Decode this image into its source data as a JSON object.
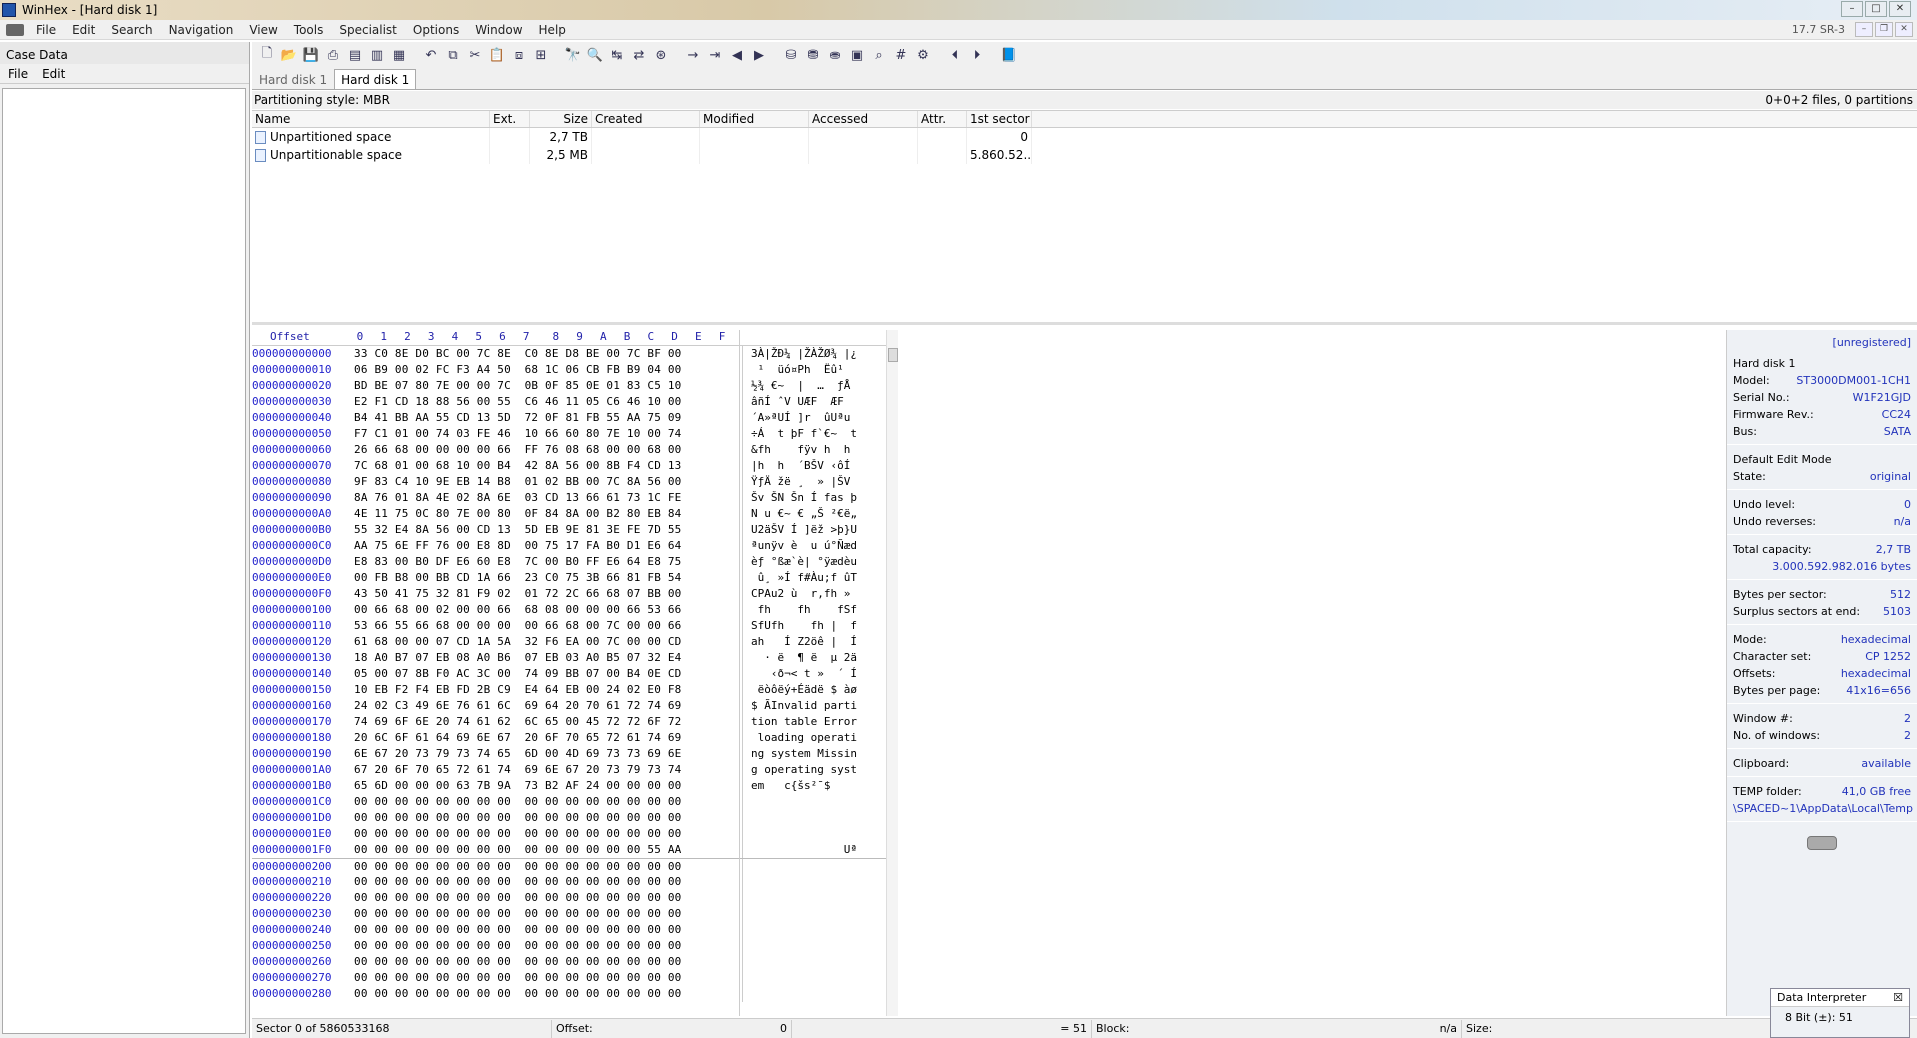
{
  "window": {
    "title": "WinHex - [Hard disk 1]",
    "version": "17.7 SR-3"
  },
  "menu": [
    "File",
    "Edit",
    "Search",
    "Navigation",
    "View",
    "Tools",
    "Specialist",
    "Options",
    "Window",
    "Help"
  ],
  "case_panel": {
    "title": "Case Data",
    "menu": [
      "File",
      "Edit"
    ]
  },
  "tabs": [
    "Hard disk 1",
    "Hard disk 1"
  ],
  "info": {
    "partitioning": "Partitioning style: MBR",
    "summary": "0+0+2 files, 0 partitions"
  },
  "file_list": {
    "columns": [
      "Name",
      "Ext.",
      "Size",
      "Created",
      "Modified",
      "Accessed",
      "Attr.",
      "1st sector ▴"
    ],
    "rows": [
      [
        "Unpartitioned space",
        "",
        "2,7 TB",
        "",
        "",
        "",
        "",
        "0"
      ],
      [
        "Unpartitionable space",
        "",
        "2,5 MB",
        "",
        "",
        "",
        "",
        "5.860.52..."
      ]
    ]
  },
  "hex": {
    "header_offset": "Offset",
    "columns": [
      "0",
      "1",
      "2",
      "3",
      "4",
      "5",
      "6",
      "7",
      "8",
      "9",
      "A",
      "B",
      "C",
      "D",
      "E",
      "F"
    ],
    "rows": [
      [
        "000000000000",
        "33 C0 8E D0 BC 00 7C 8E  C0 8E D8 BE 00 7C BF 00",
        "3À|ŽÐ¼ |ŽÀŽØ¾ |¿"
      ],
      [
        "000000000010",
        "06 B9 00 02 FC F3 A4 50  68 1C 06 CB FB B9 04 00",
        " ¹  üó¤Ph  Ëû¹ "
      ],
      [
        "000000000020",
        "BD BE 07 80 7E 00 00 7C  0B 0F 85 0E 01 83 C5 10",
        "½¾ €~  |  …  ƒÅ"
      ],
      [
        "000000000030",
        "E2 F1 CD 18 88 56 00 55  C6 46 11 05 C6 46 10 00",
        "âñÍ ˆV UÆF  ÆF"
      ],
      [
        "000000000040",
        "B4 41 BB AA 55 CD 13 5D  72 0F 81 FB 55 AA 75 09",
        "´A»ªUÍ ]r  ûUªu"
      ],
      [
        "000000000050",
        "F7 C1 01 00 74 03 FE 46  10 66 60 80 7E 10 00 74",
        "÷Á  t þF f`€~  t"
      ],
      [
        "000000000060",
        "26 66 68 00 00 00 00 66  FF 76 08 68 00 00 68 00",
        "&fh    fÿv h  h"
      ],
      [
        "000000000070",
        "7C 68 01 00 68 10 00 B4  42 8A 56 00 8B F4 CD 13",
        "|h  h  ´BŠV ‹ôÍ"
      ],
      [
        "000000000080",
        "9F 83 C4 10 9E EB 14 B8  01 02 BB 00 7C 8A 56 00",
        "ŸƒÄ žë ¸  » |ŠV"
      ],
      [
        "000000000090",
        "8A 76 01 8A 4E 02 8A 6E  03 CD 13 66 61 73 1C FE",
        "Šv ŠN Šn Í fas þ"
      ],
      [
        "0000000000A0",
        "4E 11 75 0C 80 7E 00 80  0F 84 8A 00 B2 80 EB 84",
        "N u €~ € „Š ²€ë„"
      ],
      [
        "0000000000B0",
        "55 32 E4 8A 56 00 CD 13  5D EB 9E 81 3E FE 7D 55",
        "U2äŠV Í ]ëž >þ}U"
      ],
      [
        "0000000000C0",
        "AA 75 6E FF 76 00 E8 8D  00 75 17 FA B0 D1 E6 64",
        "ªunÿv è  u ú°Ñæd"
      ],
      [
        "0000000000D0",
        "E8 83 00 B0 DF E6 60 E8  7C 00 B0 FF E6 64 E8 75",
        "èƒ °ßæ`è| °ÿædèu"
      ],
      [
        "0000000000E0",
        "00 FB B8 00 BB CD 1A 66  23 C0 75 3B 66 81 FB 54",
        " û¸ »Í f#Àu;f ûT"
      ],
      [
        "0000000000F0",
        "43 50 41 75 32 81 F9 02  01 72 2C 66 68 07 BB 00",
        "CPAu2 ù  r,fh »"
      ],
      [
        "000000000100",
        "00 66 68 00 02 00 00 66  68 08 00 00 00 66 53 66",
        " fh    fh    fSf"
      ],
      [
        "000000000110",
        "53 66 55 66 68 00 00 00  00 66 68 00 7C 00 00 66",
        "SfUfh    fh |  f"
      ],
      [
        "000000000120",
        "61 68 00 00 07 CD 1A 5A  32 F6 EA 00 7C 00 00 CD",
        "ah   Í Z2öê |  Í"
      ],
      [
        "000000000130",
        "18 A0 B7 07 EB 08 A0 B6  07 EB 03 A0 B5 07 32 E4",
        "  · ë  ¶ ë  µ 2ä"
      ],
      [
        "000000000140",
        "05 00 07 8B F0 AC 3C 00  74 09 BB 07 00 B4 0E CD",
        "   ‹ð¬< t »  ´ Í"
      ],
      [
        "000000000150",
        "10 EB F2 F4 EB FD 2B C9  E4 64 EB 00 24 02 E0 F8",
        " ëòôëý+Éädë $ àø"
      ],
      [
        "000000000160",
        "24 02 C3 49 6E 76 61 6C  69 64 20 70 61 72 74 69",
        "$ ÃInvalid parti"
      ],
      [
        "000000000170",
        "74 69 6F 6E 20 74 61 62  6C 65 00 45 72 72 6F 72",
        "tion table Error"
      ],
      [
        "000000000180",
        "20 6C 6F 61 64 69 6E 67  20 6F 70 65 72 61 74 69",
        " loading operati"
      ],
      [
        "000000000190",
        "6E 67 20 73 79 73 74 65  6D 00 4D 69 73 73 69 6E",
        "ng system Missin"
      ],
      [
        "0000000001A0",
        "67 20 6F 70 65 72 61 74  69 6E 67 20 73 79 73 74",
        "g operating syst"
      ],
      [
        "0000000001B0",
        "65 6D 00 00 00 63 7B 9A  73 B2 AF 24 00 00 00 00",
        "em   c{šs²¯$"
      ],
      [
        "0000000001C0",
        "00 00 00 00 00 00 00 00  00 00 00 00 00 00 00 00",
        ""
      ],
      [
        "0000000001D0",
        "00 00 00 00 00 00 00 00  00 00 00 00 00 00 00 00",
        ""
      ],
      [
        "0000000001E0",
        "00 00 00 00 00 00 00 00  00 00 00 00 00 00 00 00",
        ""
      ],
      [
        "0000000001F0",
        "00 00 00 00 00 00 00 00  00 00 00 00 00 00 55 AA",
        "              Uª"
      ],
      [
        "000000000200",
        "00 00 00 00 00 00 00 00  00 00 00 00 00 00 00 00",
        ""
      ],
      [
        "000000000210",
        "00 00 00 00 00 00 00 00  00 00 00 00 00 00 00 00",
        ""
      ],
      [
        "000000000220",
        "00 00 00 00 00 00 00 00  00 00 00 00 00 00 00 00",
        ""
      ],
      [
        "000000000230",
        "00 00 00 00 00 00 00 00  00 00 00 00 00 00 00 00",
        ""
      ],
      [
        "000000000240",
        "00 00 00 00 00 00 00 00  00 00 00 00 00 00 00 00",
        ""
      ],
      [
        "000000000250",
        "00 00 00 00 00 00 00 00  00 00 00 00 00 00 00 00",
        ""
      ],
      [
        "000000000260",
        "00 00 00 00 00 00 00 00  00 00 00 00 00 00 00 00",
        ""
      ],
      [
        "000000000270",
        "00 00 00 00 00 00 00 00  00 00 00 00 00 00 00 00",
        ""
      ],
      [
        "000000000280",
        "00 00 00 00 00 00 00 00  00 00 00 00 00 00 00 00",
        ""
      ]
    ]
  },
  "details": {
    "unregistered": "[unregistered]",
    "groups": [
      [
        [
          "Hard disk 1",
          ""
        ],
        [
          "Model:",
          "ST3000DM001-1CH1"
        ],
        [
          "Serial No.:",
          "W1F21GJD"
        ],
        [
          "Firmware Rev.:",
          "CC24"
        ],
        [
          "Bus:",
          "SATA"
        ]
      ],
      [
        [
          "Default Edit Mode",
          ""
        ],
        [
          "State:",
          "original"
        ]
      ],
      [
        [
          "Undo level:",
          "0"
        ],
        [
          "Undo reverses:",
          "n/a"
        ]
      ],
      [
        [
          "Total capacity:",
          "2,7 TB"
        ],
        [
          "",
          "3.000.592.982.016 bytes"
        ]
      ],
      [
        [
          "Bytes per sector:",
          "512"
        ],
        [
          "Surplus sectors at end:",
          "5103"
        ]
      ],
      [
        [
          "Mode:",
          "hexadecimal"
        ],
        [
          "Character set:",
          "CP 1252"
        ],
        [
          "Offsets:",
          "hexadecimal"
        ],
        [
          "Bytes per page:",
          "41x16=656"
        ]
      ],
      [
        [
          "Window #:",
          "2"
        ],
        [
          "No. of windows:",
          "2"
        ]
      ],
      [
        [
          "Clipboard:",
          "available"
        ]
      ],
      [
        [
          "TEMP folder:",
          "41,0 GB free"
        ],
        [
          "",
          "\\SPACED~1\\AppData\\Local\\Temp"
        ]
      ]
    ]
  },
  "statusbar": {
    "sector": "Sector 0 of 5860533168",
    "offset_label": "Offset:",
    "offset_value": "0",
    "eq": "= 51",
    "block_label": "Block:",
    "block_value": "n/a",
    "size_label": "Size:"
  },
  "data_interpreter": {
    "title": "Data Interpreter",
    "line": "8 Bit (±): 51"
  }
}
